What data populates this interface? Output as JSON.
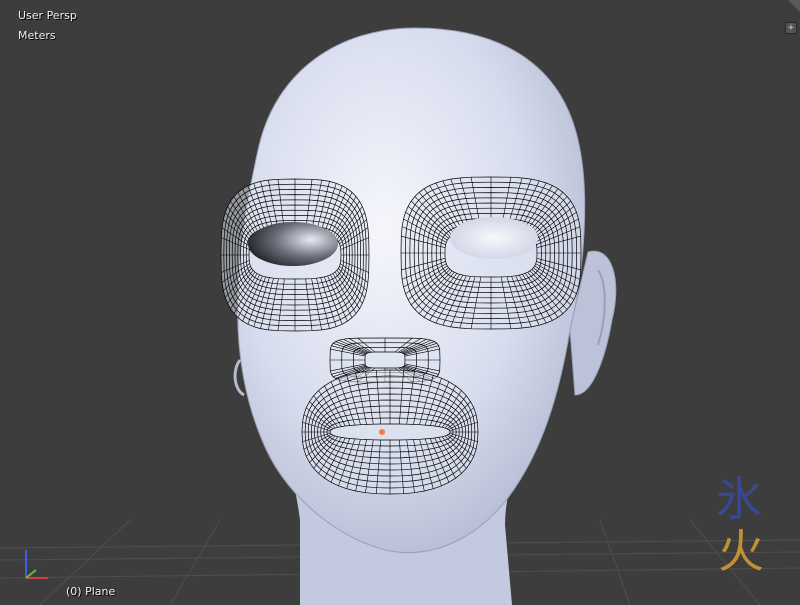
{
  "viewport": {
    "view_name": "User Persp",
    "units": "Meters",
    "object_info": "(0) Plane"
  },
  "watermark": {
    "ice_char": "氷",
    "fire_char": "火",
    "ice_color": "#3a4aa0",
    "fire_color": "#d8a030"
  },
  "colors": {
    "background": "#3d3d3d",
    "grid_line": "#505050",
    "skin": "#c9cfe4",
    "wire": "#000000",
    "axis_x": "#d04040",
    "axis_y": "#60c040",
    "axis_z": "#4060e0",
    "origin": "#ff7a2a"
  },
  "icons": {
    "expand": "plus-icon",
    "axis_gizmo": "axes-icon"
  }
}
